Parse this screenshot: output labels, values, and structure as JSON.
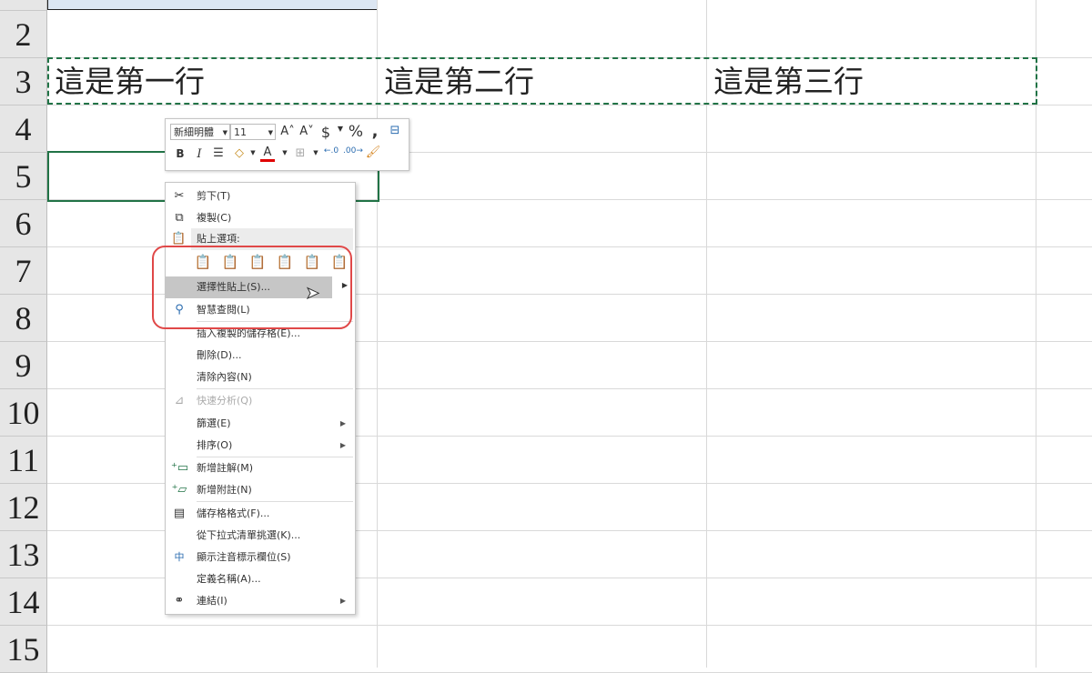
{
  "rows": [
    "2",
    "3",
    "4",
    "5",
    "6",
    "7",
    "8",
    "9",
    "10",
    "11",
    "12",
    "13",
    "14",
    "15"
  ],
  "cells": {
    "a3": "這是第一行",
    "b3": "這是第二行",
    "c3": "這是第三行"
  },
  "mini_toolbar": {
    "font": "新細明體",
    "size": "11",
    "bold": "B",
    "italic": "I",
    "percent": "%",
    "dollar": "$"
  },
  "menu": {
    "cut": "剪下(T)",
    "copy": "複製(C)",
    "paste_options": "貼上選項:",
    "paste_special": "選擇性貼上(S)...",
    "smart_lookup": "智慧查閱(L)",
    "insert_copied": "插入複製的儲存格(E)...",
    "delete": "刪除(D)...",
    "clear": "清除內容(N)",
    "quick_analysis": "快速分析(Q)",
    "filter": "篩選(E)",
    "sort": "排序(O)",
    "new_comment": "新增註解(M)",
    "new_note": "新增附註(N)",
    "format_cells": "儲存格格式(F)...",
    "pick_list": "從下拉式清單挑選(K)...",
    "phonetic": "顯示注音標示欄位(S)",
    "define_name": "定義名稱(A)...",
    "link": "連結(I)"
  },
  "colors": {
    "accent_green": "#217346",
    "highlight_red": "#e04848",
    "menu_hover": "#c6c6c6"
  }
}
